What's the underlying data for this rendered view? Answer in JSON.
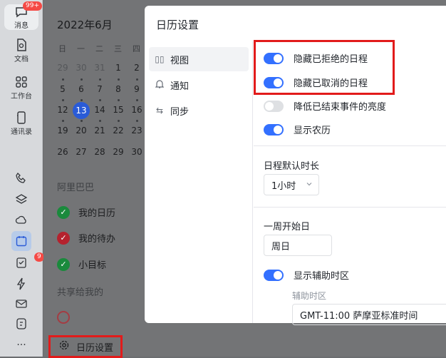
{
  "rail": {
    "messages": {
      "label": "消息",
      "badge": "99+"
    },
    "docs": {
      "label": "文档"
    },
    "workspace": {
      "label": "工作台"
    },
    "contacts": {
      "label": "通讯录"
    },
    "tasks_badge": "9",
    "more": "···"
  },
  "calendar": {
    "month": "2022年6月",
    "weekdays": [
      "日",
      "一",
      "二",
      "三",
      "四"
    ],
    "rows": [
      [
        "29",
        "30",
        "31",
        "1",
        "2"
      ],
      [
        "5",
        "6",
        "7",
        "8",
        "9"
      ],
      [
        "12",
        "13",
        "14",
        "15",
        "16"
      ],
      [
        "19",
        "20",
        "21",
        "22",
        "23"
      ],
      [
        "26",
        "27",
        "28",
        "29",
        "30"
      ]
    ],
    "today": "13",
    "section_org": "阿里巴巴",
    "items": [
      {
        "label": "我的日历",
        "color": "#1a8a3c"
      },
      {
        "label": "我的待办",
        "color": "#b5222e"
      },
      {
        "label": "小目标",
        "color": "#1a8a3c"
      }
    ],
    "section_shared": "共享给我的",
    "settings_entry": "日历设置"
  },
  "dialog": {
    "title": "日历设置",
    "nav": [
      {
        "label": "视图",
        "icon": "view-icon"
      },
      {
        "label": "通知",
        "icon": "bell-icon"
      },
      {
        "label": "同步",
        "icon": "sync-icon"
      }
    ],
    "toggles": [
      {
        "label": "隐藏已拒绝的日程",
        "on": true
      },
      {
        "label": "隐藏已取消的日程",
        "on": true
      },
      {
        "label": "降低已结束事件的亮度",
        "on": false
      },
      {
        "label": "显示农历",
        "on": true
      }
    ],
    "default_duration": {
      "label": "日程默认时长",
      "value": "1小时"
    },
    "week_start": {
      "label": "一周开始日",
      "value": "周日"
    },
    "aux_timezone": {
      "label": "显示辅助时区",
      "on": true,
      "sub_label": "辅助时区",
      "value": "GMT-11:00 萨摩亚标准时间"
    }
  },
  "colors": {
    "accent": "#3370ff",
    "highlight": "#e21b1b"
  }
}
